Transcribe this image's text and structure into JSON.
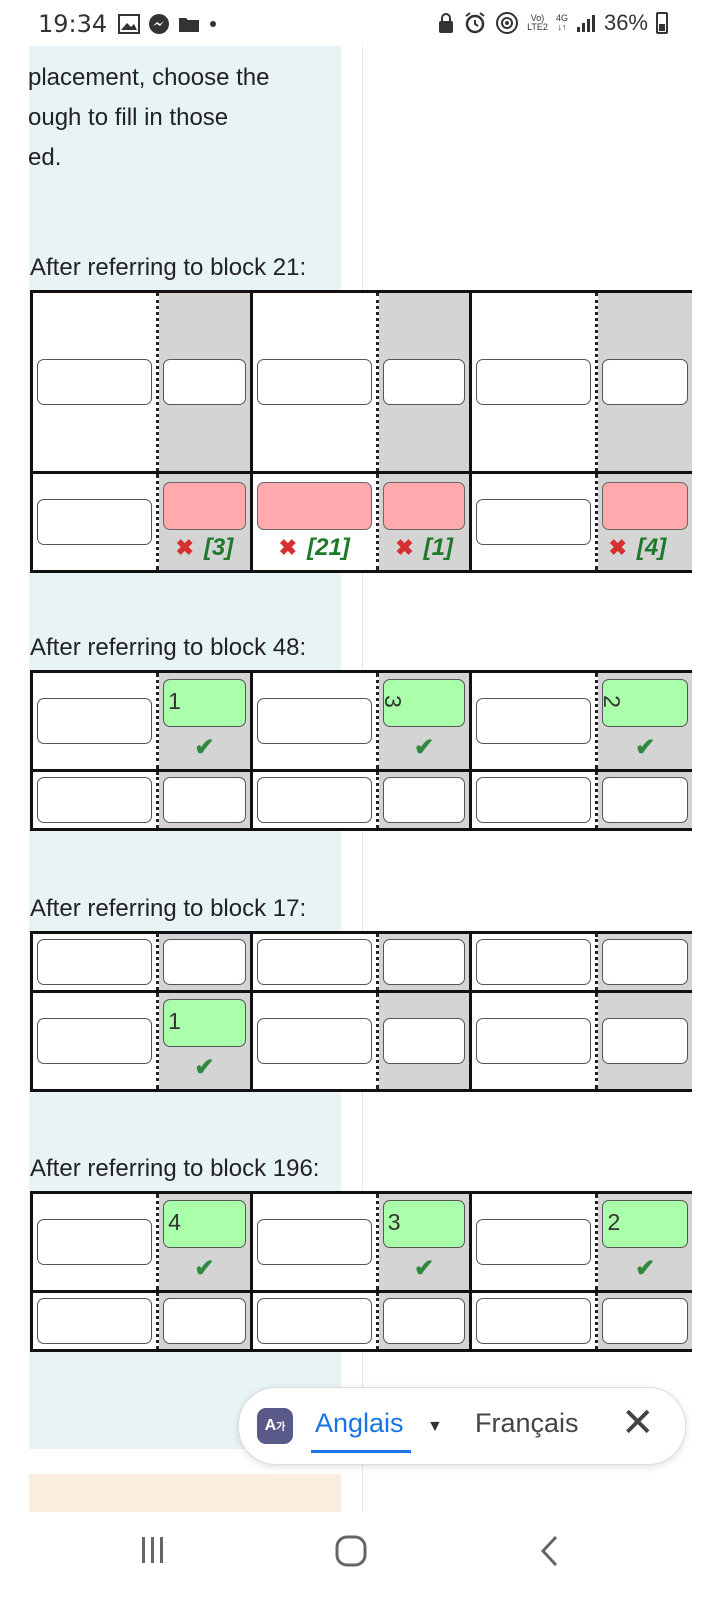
{
  "status": {
    "time": "19:34",
    "network_top": "Vo)",
    "network_bottom": "LTE2",
    "net_type": "4G",
    "battery": "36%"
  },
  "intro_lines": [
    "placement, choose the",
    "ough to fill in those",
    "ed."
  ],
  "sections": [
    {
      "title": "After referring to block 21:",
      "marks": [
        "[3]",
        "[21]",
        "[1]",
        "[4]"
      ]
    },
    {
      "title": "After referring to block 48:",
      "values": [
        "1",
        "3",
        "2"
      ]
    },
    {
      "title": "After referring to block 17:",
      "values": [
        "1"
      ]
    },
    {
      "title": "After referring to block 196:",
      "values": [
        "4",
        "3",
        "2"
      ]
    }
  ],
  "translate": {
    "source_lang": "Anglais",
    "target_lang": "Français",
    "icon_label": "A",
    "icon_sub": "가"
  },
  "icons": {
    "check": "check-icon",
    "cross": "cross-icon",
    "close": "close-icon"
  },
  "colors": {
    "green_box": "#aaffaa",
    "red_box": "#ffaaad",
    "gray_cell": "#d4d4d4",
    "accent": "#1a73e8"
  }
}
